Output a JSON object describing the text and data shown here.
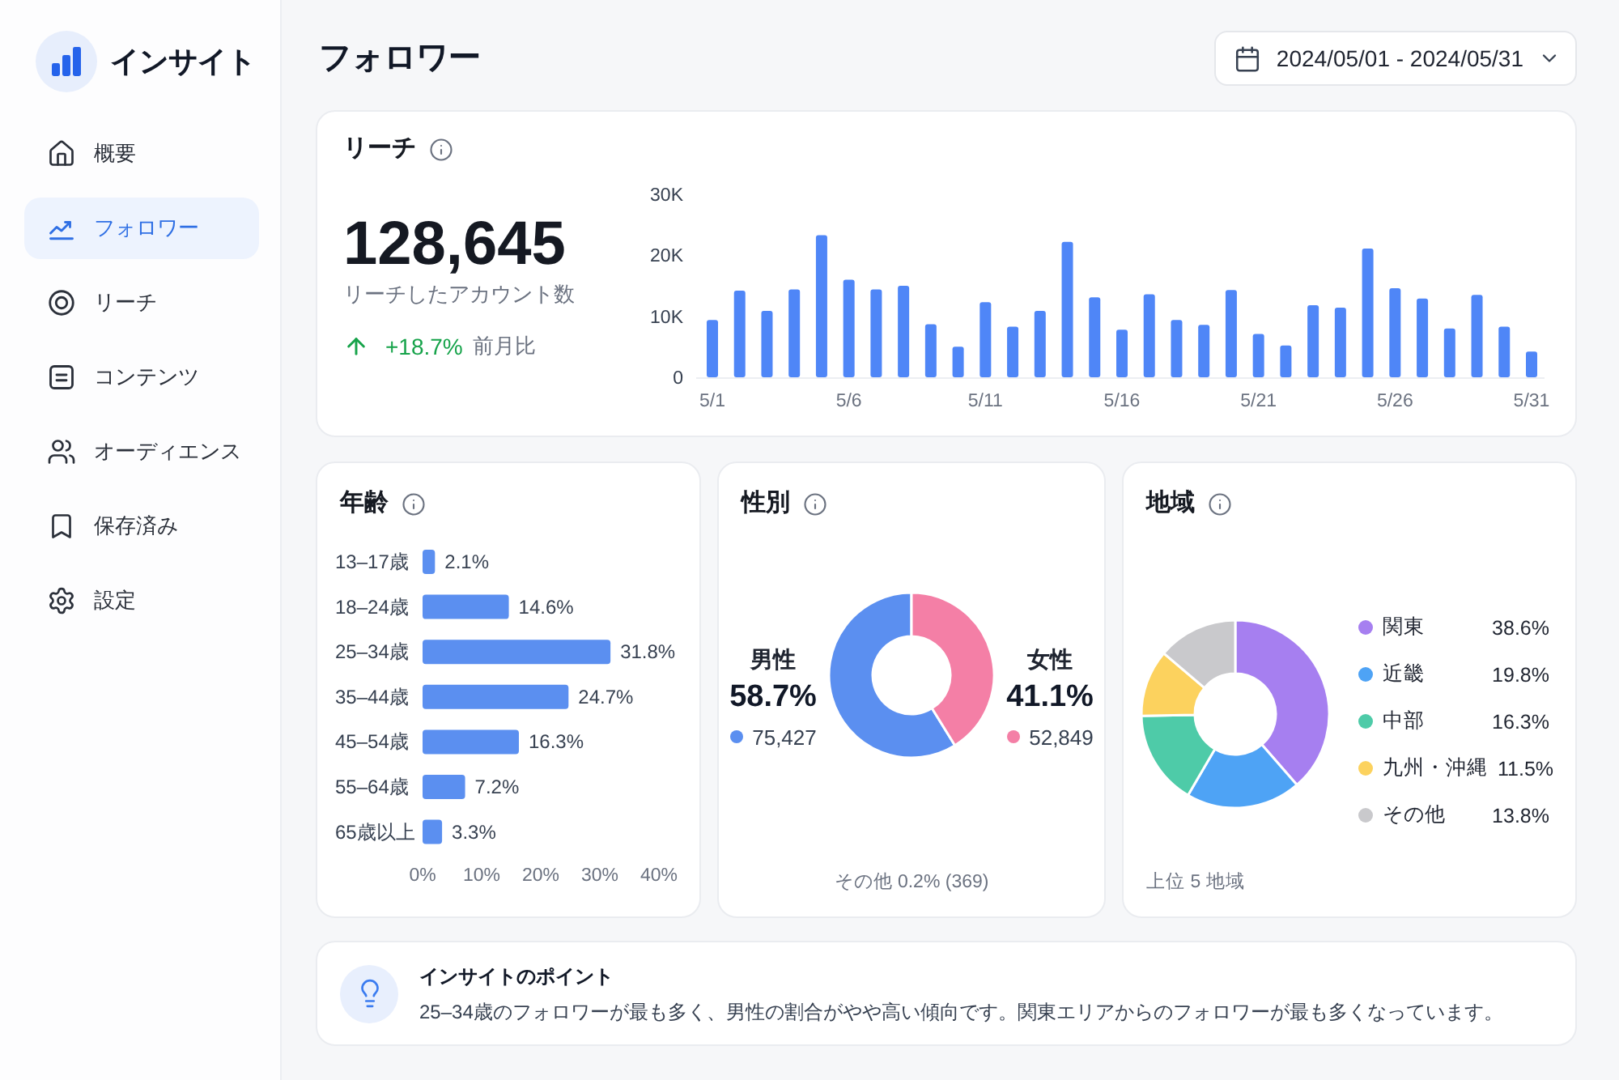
{
  "sidebar": {
    "app_name": "インサイト",
    "items": [
      {
        "label": "概要",
        "selected": false
      },
      {
        "label": "フォロワー",
        "selected": true
      },
      {
        "label": "リーチ",
        "selected": false
      },
      {
        "label": "コンテンツ",
        "selected": false
      },
      {
        "label": "オーディエンス",
        "selected": false
      },
      {
        "label": "保存済み",
        "selected": false
      },
      {
        "label": "設定",
        "selected": false
      }
    ]
  },
  "header": {
    "title": "フォロワー",
    "date_range": "2024/05/01 - 2024/05/31"
  },
  "reach": {
    "title": "リーチ",
    "total": "128,645",
    "total_label": "リーチしたアカウント数",
    "change": "+18.7%",
    "change_label": "前月比",
    "chart_data": {
      "type": "bar",
      "categories": [
        "5/1",
        null,
        null,
        null,
        null,
        "5/6",
        null,
        null,
        null,
        null,
        "5/11",
        null,
        null,
        null,
        null,
        "5/16",
        null,
        null,
        null,
        null,
        "5/21",
        null,
        null,
        null,
        null,
        "5/26",
        null,
        null,
        null,
        null,
        "5/31"
      ],
      "values": [
        9400,
        14200,
        10900,
        14400,
        23300,
        16000,
        14400,
        15000,
        8700,
        5000,
        12300,
        8300,
        10900,
        22200,
        13100,
        7800,
        13600,
        9400,
        8600,
        14300,
        7100,
        5200,
        11800,
        11400,
        21100,
        14600,
        12900,
        8000,
        13500,
        8300,
        4200
      ],
      "ylim": [
        0,
        30000
      ],
      "yticks": [
        {
          "value": 0,
          "label": "0"
        },
        {
          "value": 10000,
          "label": "10K"
        },
        {
          "value": 20000,
          "label": "20K"
        },
        {
          "value": 30000,
          "label": "30K"
        }
      ]
    }
  },
  "age": {
    "title": "年齢",
    "chart_data": {
      "type": "bar",
      "orientation": "horizontal",
      "categories": [
        "13–17歳",
        "18–24歳",
        "25–34歳",
        "35–44歳",
        "45–54歳",
        "55–64歳",
        "65歳以上"
      ],
      "values": [
        2.1,
        14.6,
        31.8,
        24.7,
        16.3,
        7.2,
        3.3
      ],
      "value_labels": [
        "2.1%",
        "14.6%",
        "31.8%",
        "24.7%",
        "16.3%",
        "7.2%",
        "3.3%"
      ],
      "xlim": [
        0,
        40
      ],
      "xticks": [
        {
          "value": 0,
          "label": "0%"
        },
        {
          "value": 10,
          "label": "10%"
        },
        {
          "value": 20,
          "label": "20%"
        },
        {
          "value": 30,
          "label": "30%"
        },
        {
          "value": 40,
          "label": "40%"
        }
      ]
    }
  },
  "gender": {
    "title": "性別",
    "groups": [
      {
        "share": "58.7%",
        "count": "75,427",
        "color": "#5b8ff0"
      },
      {
        "share": "41.1%",
        "count": "52,849",
        "color": "#f47fa6"
      }
    ],
    "chart_data": {
      "type": "donut",
      "categories": [
        "男性",
        "女性"
      ],
      "values": [
        58.7,
        41.1
      ]
    },
    "note": "その他 0.2% (369)"
  },
  "region": {
    "title": "地域",
    "legend": [
      {
        "share": "38.6%",
        "color": "#a67ff0"
      },
      {
        "share": "19.8%",
        "color": "#4ea3f5"
      },
      {
        "share": "16.3%",
        "color": "#4ecba8"
      },
      {
        "share": "11.5%",
        "color": "#fcd25e"
      },
      {
        "share": "13.8%",
        "color": "#c9c9cc"
      }
    ],
    "chart_data": {
      "type": "donut",
      "categories": [
        "関東",
        "近畿",
        "中部",
        "九州・沖縄",
        "その他"
      ],
      "values": [
        38.6,
        19.8,
        16.3,
        11.5,
        13.8
      ]
    },
    "note": "上位 5 地域"
  },
  "insight": {
    "title": "インサイトのポイント",
    "text": "25–34歳のフォロワーが最も多く、男性の割合がやや高い傾向です。関東エリアからのフォロワーが最も多くなっています。"
  }
}
